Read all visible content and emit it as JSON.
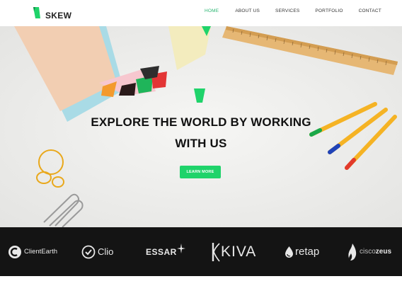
{
  "brand": {
    "name": "SKEW",
    "accent": "#2bb673"
  },
  "nav": {
    "items": [
      {
        "label": "HOME",
        "active": true
      },
      {
        "label": "ABOUT US",
        "active": false
      },
      {
        "label": "SERVICES",
        "active": false
      },
      {
        "label": "PORTFOLIO",
        "active": false
      },
      {
        "label": "CONTACT",
        "active": false
      }
    ]
  },
  "hero": {
    "title_line1": "EXPLORE THE WORLD BY WORKING",
    "title_line2": "WITH US",
    "cta_label": "LEARN MORE",
    "cta_color": "#1fd36a"
  },
  "clients": [
    {
      "name": "ClientEarth",
      "icon": "clientearth-logo-icon"
    },
    {
      "name": "Clio",
      "icon": "clio-check-icon"
    },
    {
      "name": "ESSAR",
      "icon": "essar-star-icon"
    },
    {
      "name": "KIVA",
      "icon": "kiva-logo-icon"
    },
    {
      "name": "retap",
      "icon": "retap-drop-icon"
    },
    {
      "name": "cisco",
      "name2": "zeus",
      "icon": "ciscozeus-flame-icon"
    }
  ]
}
